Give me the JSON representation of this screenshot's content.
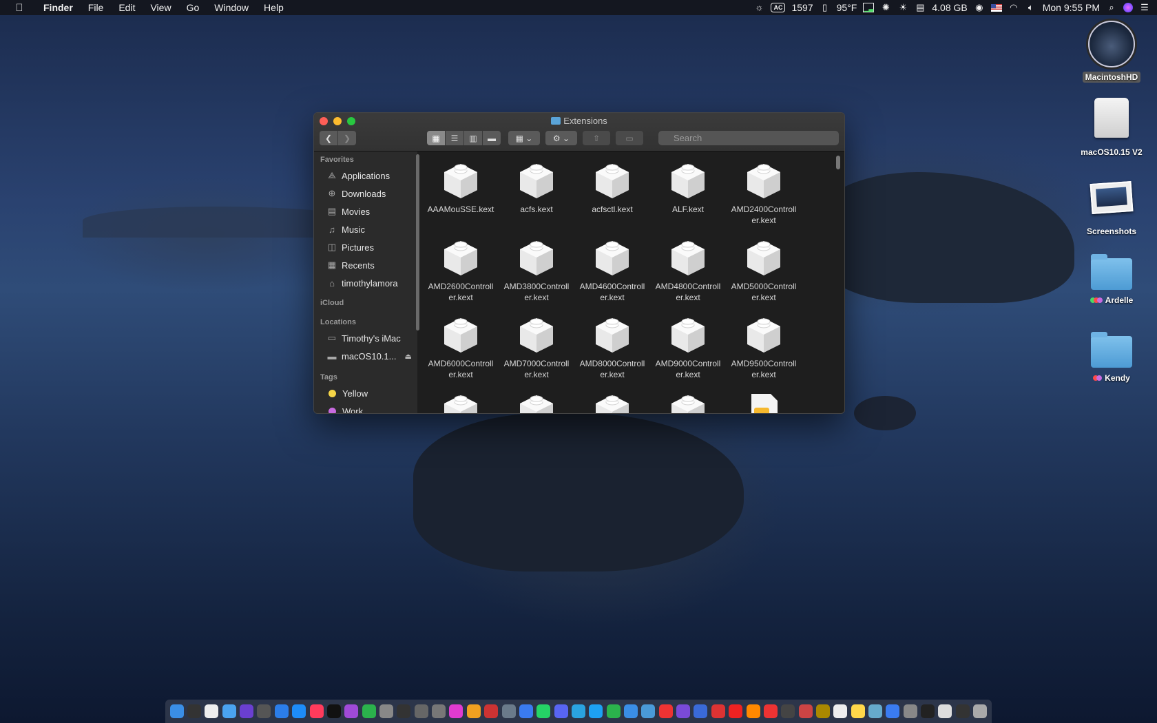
{
  "menubar": {
    "app": "Finder",
    "items": [
      "File",
      "Edit",
      "View",
      "Go",
      "Window",
      "Help"
    ],
    "status": {
      "ac": "AC",
      "count": "1597",
      "temp": "95°F",
      "memory": "4.08 GB",
      "clock": "Mon 9:55 PM"
    }
  },
  "desktop": {
    "icons": [
      {
        "label": "MacintoshHD"
      },
      {
        "label": "macOS10.15 V2"
      },
      {
        "label": "Screenshots"
      },
      {
        "label": "Ardelle"
      },
      {
        "label": "Kendy"
      }
    ]
  },
  "finder": {
    "title": "Extensions",
    "search_placeholder": "Search",
    "sidebar": {
      "favorites_header": "Favorites",
      "favorites": [
        "Applications",
        "Downloads",
        "Movies",
        "Music",
        "Pictures",
        "Recents",
        "timothylamora"
      ],
      "icloud_header": "iCloud",
      "locations_header": "Locations",
      "locations": [
        "Timothy's iMac",
        "macOS10.1..."
      ],
      "tags_header": "Tags",
      "tags": [
        "Yellow",
        "Work"
      ]
    },
    "files": [
      "AAAMouSSE.kext",
      "acfs.kext",
      "acfsctl.kext",
      "ALF.kext",
      "AMD2400Controll\ner.kext",
      "AMD2600Controll\ner.kext",
      "AMD3800Controll\ner.kext",
      "AMD4600Controll\ner.kext",
      "AMD4800Controll\ner.kext",
      "AMD5000Controll\ner.kext",
      "AMD6000Controll\ner.kext",
      "AMD7000Controll\ner.kext",
      "AMD8000Controll\ner.kext",
      "AMD9000Controll\ner.kext",
      "AMD9500Controll\ner.kext"
    ]
  },
  "colors": {
    "close": "#ff5f57",
    "minimize": "#febc2e",
    "zoom": "#28c840",
    "tag_yellow": "#f5d547",
    "tag_work": "#c86be0"
  }
}
